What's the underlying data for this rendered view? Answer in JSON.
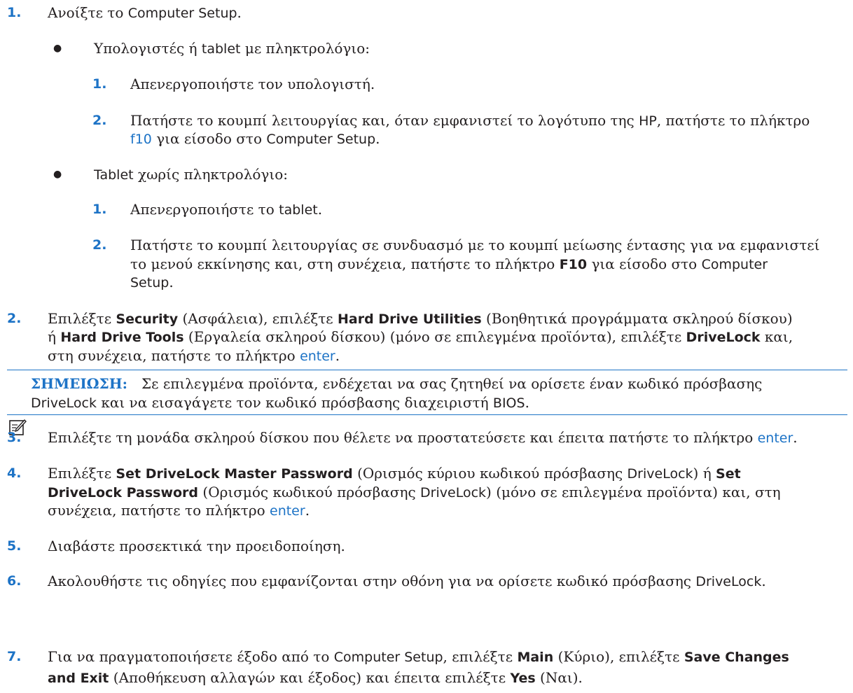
{
  "accent_color": "#1d73c6",
  "step1": {
    "num": "1.",
    "text_a": "Ανοίξτε το ",
    "app": "Computer Setup",
    "text_b": "."
  },
  "bullet_keyboard": {
    "symbol": "●",
    "label_a": "Υπολογιστές ή ",
    "tablet": "tablet",
    "label_b": " με πληκτρολόγιο:",
    "sub1": {
      "num": "1.",
      "text": "Απενεργοποιήστε τον υπολογιστή."
    },
    "sub2": {
      "num": "2.",
      "line1_a": "Πατήστε το κουμπί λειτουργίας και, όταν εμφανιστεί το λογότυπο της ",
      "hp": "HP",
      "line1_b": ", πατήστε το πλήκτρο",
      "key": "f10",
      "line2_a": " για είσοδο στο ",
      "app": "Computer Setup",
      "line2_b": "."
    }
  },
  "bullet_tablet": {
    "symbol": "●",
    "tablet": "Tablet",
    "label": " χωρίς πληκτρολόγιο:",
    "sub1": {
      "num": "1.",
      "text_a": "Απενεργοποιήστε το ",
      "tablet": "tablet",
      "text_b": "."
    },
    "sub2": {
      "num": "2.",
      "line1": "Πατήστε το κουμπί λειτουργίας σε συνδυασμό με το κουμπί μείωσης έντασης για να εμφανιστεί",
      "line2_a": "το μενού εκκίνησης και, στη συνέχεια, πατήστε το πλήκτρο ",
      "key": "F10",
      "line2_b": " για είσοδο στο ",
      "app": "Computer",
      "line3": "Setup",
      "line3_b": "."
    }
  },
  "step2": {
    "num": "2.",
    "t1": "Επιλέξτε ",
    "security": "Security",
    "t2": " (Ασφάλεια), επιλέξτε ",
    "hdu": "Hard Drive Utilities",
    "t3": " (Βοηθητικά προγράμματα σκληρού δίσκου)",
    "t4": "ή ",
    "hdt": "Hard Drive Tools",
    "t5": " (Εργαλεία σκληρού δίσκου) (μόνο σε επιλεγμένα προϊόντα), επιλέξτε ",
    "drivelock": "DriveLock",
    "t6": " και,",
    "t7": "στη συνέχεια, πατήστε το πλήκτρο ",
    "key": "enter",
    "t8": "."
  },
  "note": {
    "icon": "note-pencil-icon",
    "label": "ΣΗΜΕΙΩΣΗ:",
    "line1": "Σε επιλεγμένα προϊόντα, ενδέχεται να σας ζητηθεί να ορίσετε έναν κωδικό πρόσβασης",
    "drivelock": "DriveLock",
    "line2": " και να εισαγάγετε τον κωδικό πρόσβασης διαχειριστή ",
    "bios": "BIOS",
    "line2_b": "."
  },
  "step3": {
    "num": "3.",
    "text": "Επιλέξτε τη μονάδα σκληρού δίσκου που θέλετε να προστατεύσετε και έπειτα πατήστε το πλήκτρο ",
    "key": "enter",
    "end": "."
  },
  "step4": {
    "num": "4.",
    "t1": "Επιλέξτε ",
    "opt1": "Set DriveLock Master Password",
    "t2": " (Ορισμός κύριου κωδικού πρόσβασης ",
    "drivelock": "DriveLock",
    "t3": ") ή ",
    "set": "Set",
    "opt2": "DriveLock Password",
    "t4": " (Ορισμός κωδικού πρόσβασης ",
    "drivelock2": "DriveLock",
    "t5": ") (μόνο σε επιλεγμένα προϊόντα) και, στη",
    "t6": "συνέχεια, πατήστε το πλήκτρο ",
    "key": "enter",
    "t7": "."
  },
  "step5": {
    "num": "5.",
    "text": "Διαβάστε προσεκτικά την προειδοποίηση."
  },
  "step6": {
    "num": "6.",
    "text": "Ακολουθήστε τις οδηγίες που εμφανίζονται στην οθόνη για να ορίσετε κωδικό πρόσβασης ",
    "drivelock": "DriveLock",
    "end": "."
  },
  "step7": {
    "num": "7.",
    "t1": "Για να πραγματοποιήσετε έξοδο από το ",
    "app": "Computer Setup",
    "t2": ", επιλέξτε ",
    "main": "Main",
    "t3": " (Κύριο), επιλέξτε ",
    "save": "Save Changes",
    "save2": "and Exit",
    "t4": " (Αποθήκευση αλλαγών και έξοδος) και έπειτα επιλέξτε ",
    "yes": "Yes",
    "t5": " (Ναι)."
  }
}
